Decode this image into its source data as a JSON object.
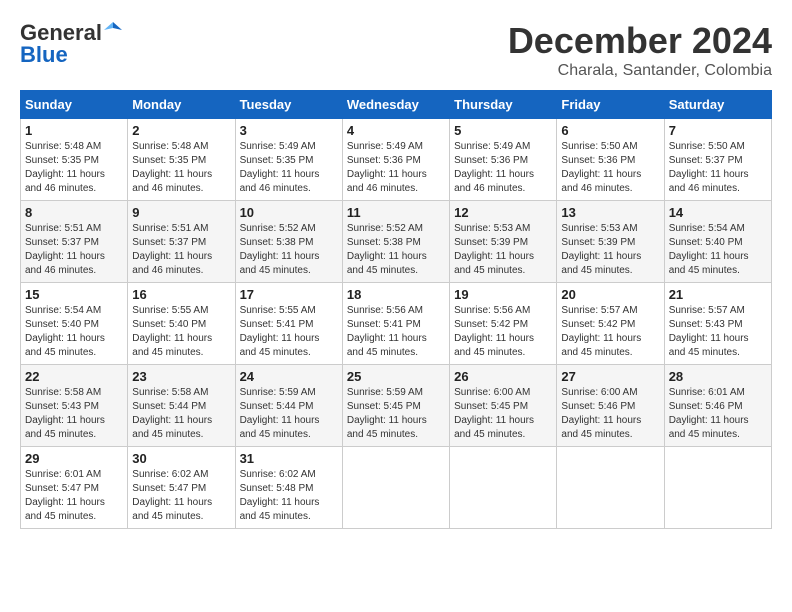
{
  "header": {
    "logo": {
      "line1": "General",
      "line2": "Blue"
    },
    "title": "December 2024",
    "location": "Charala, Santander, Colombia"
  },
  "calendar": {
    "days_of_week": [
      "Sunday",
      "Monday",
      "Tuesday",
      "Wednesday",
      "Thursday",
      "Friday",
      "Saturday"
    ],
    "weeks": [
      [
        {
          "day": "1",
          "info": "Sunrise: 5:48 AM\nSunset: 5:35 PM\nDaylight: 11 hours\nand 46 minutes."
        },
        {
          "day": "2",
          "info": "Sunrise: 5:48 AM\nSunset: 5:35 PM\nDaylight: 11 hours\nand 46 minutes."
        },
        {
          "day": "3",
          "info": "Sunrise: 5:49 AM\nSunset: 5:35 PM\nDaylight: 11 hours\nand 46 minutes."
        },
        {
          "day": "4",
          "info": "Sunrise: 5:49 AM\nSunset: 5:36 PM\nDaylight: 11 hours\nand 46 minutes."
        },
        {
          "day": "5",
          "info": "Sunrise: 5:49 AM\nSunset: 5:36 PM\nDaylight: 11 hours\nand 46 minutes."
        },
        {
          "day": "6",
          "info": "Sunrise: 5:50 AM\nSunset: 5:36 PM\nDaylight: 11 hours\nand 46 minutes."
        },
        {
          "day": "7",
          "info": "Sunrise: 5:50 AM\nSunset: 5:37 PM\nDaylight: 11 hours\nand 46 minutes."
        }
      ],
      [
        {
          "day": "8",
          "info": "Sunrise: 5:51 AM\nSunset: 5:37 PM\nDaylight: 11 hours\nand 46 minutes."
        },
        {
          "day": "9",
          "info": "Sunrise: 5:51 AM\nSunset: 5:37 PM\nDaylight: 11 hours\nand 46 minutes."
        },
        {
          "day": "10",
          "info": "Sunrise: 5:52 AM\nSunset: 5:38 PM\nDaylight: 11 hours\nand 45 minutes."
        },
        {
          "day": "11",
          "info": "Sunrise: 5:52 AM\nSunset: 5:38 PM\nDaylight: 11 hours\nand 45 minutes."
        },
        {
          "day": "12",
          "info": "Sunrise: 5:53 AM\nSunset: 5:39 PM\nDaylight: 11 hours\nand 45 minutes."
        },
        {
          "day": "13",
          "info": "Sunrise: 5:53 AM\nSunset: 5:39 PM\nDaylight: 11 hours\nand 45 minutes."
        },
        {
          "day": "14",
          "info": "Sunrise: 5:54 AM\nSunset: 5:40 PM\nDaylight: 11 hours\nand 45 minutes."
        }
      ],
      [
        {
          "day": "15",
          "info": "Sunrise: 5:54 AM\nSunset: 5:40 PM\nDaylight: 11 hours\nand 45 minutes."
        },
        {
          "day": "16",
          "info": "Sunrise: 5:55 AM\nSunset: 5:40 PM\nDaylight: 11 hours\nand 45 minutes."
        },
        {
          "day": "17",
          "info": "Sunrise: 5:55 AM\nSunset: 5:41 PM\nDaylight: 11 hours\nand 45 minutes."
        },
        {
          "day": "18",
          "info": "Sunrise: 5:56 AM\nSunset: 5:41 PM\nDaylight: 11 hours\nand 45 minutes."
        },
        {
          "day": "19",
          "info": "Sunrise: 5:56 AM\nSunset: 5:42 PM\nDaylight: 11 hours\nand 45 minutes."
        },
        {
          "day": "20",
          "info": "Sunrise: 5:57 AM\nSunset: 5:42 PM\nDaylight: 11 hours\nand 45 minutes."
        },
        {
          "day": "21",
          "info": "Sunrise: 5:57 AM\nSunset: 5:43 PM\nDaylight: 11 hours\nand 45 minutes."
        }
      ],
      [
        {
          "day": "22",
          "info": "Sunrise: 5:58 AM\nSunset: 5:43 PM\nDaylight: 11 hours\nand 45 minutes."
        },
        {
          "day": "23",
          "info": "Sunrise: 5:58 AM\nSunset: 5:44 PM\nDaylight: 11 hours\nand 45 minutes."
        },
        {
          "day": "24",
          "info": "Sunrise: 5:59 AM\nSunset: 5:44 PM\nDaylight: 11 hours\nand 45 minutes."
        },
        {
          "day": "25",
          "info": "Sunrise: 5:59 AM\nSunset: 5:45 PM\nDaylight: 11 hours\nand 45 minutes."
        },
        {
          "day": "26",
          "info": "Sunrise: 6:00 AM\nSunset: 5:45 PM\nDaylight: 11 hours\nand 45 minutes."
        },
        {
          "day": "27",
          "info": "Sunrise: 6:00 AM\nSunset: 5:46 PM\nDaylight: 11 hours\nand 45 minutes."
        },
        {
          "day": "28",
          "info": "Sunrise: 6:01 AM\nSunset: 5:46 PM\nDaylight: 11 hours\nand 45 minutes."
        }
      ],
      [
        {
          "day": "29",
          "info": "Sunrise: 6:01 AM\nSunset: 5:47 PM\nDaylight: 11 hours\nand 45 minutes."
        },
        {
          "day": "30",
          "info": "Sunrise: 6:02 AM\nSunset: 5:47 PM\nDaylight: 11 hours\nand 45 minutes."
        },
        {
          "day": "31",
          "info": "Sunrise: 6:02 AM\nSunset: 5:48 PM\nDaylight: 11 hours\nand 45 minutes."
        },
        {
          "day": "",
          "info": ""
        },
        {
          "day": "",
          "info": ""
        },
        {
          "day": "",
          "info": ""
        },
        {
          "day": "",
          "info": ""
        }
      ]
    ]
  }
}
